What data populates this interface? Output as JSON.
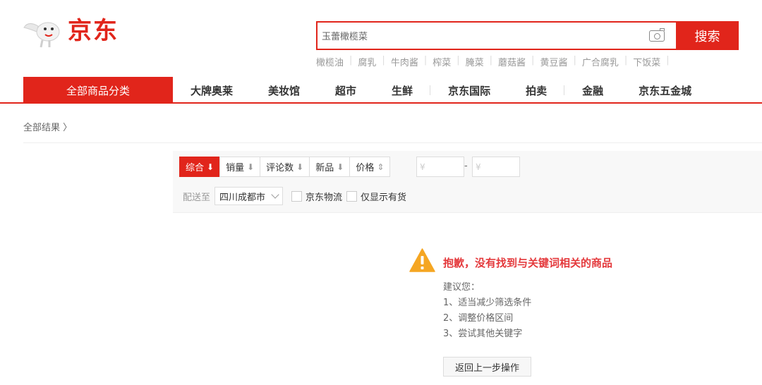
{
  "brand": {
    "logo_text": "京东",
    "color": "#e1251b"
  },
  "search": {
    "value": "玉蕾橄榄菜",
    "button": "搜索"
  },
  "hotwords": [
    "橄榄油",
    "腐乳",
    "牛肉酱",
    "榨菜",
    "腌菜",
    "蘑菇酱",
    "黄豆酱",
    "广合腐乳",
    "下饭菜"
  ],
  "nav": {
    "all_categories": "全部商品分类",
    "items": [
      "大牌奥莱",
      "美妆馆",
      "超市",
      "生鲜",
      "京东国际",
      "拍卖",
      "金融",
      "京东五金城"
    ]
  },
  "breadcrumb": {
    "label": "全部结果 〉"
  },
  "filter": {
    "sort": [
      {
        "label": "综合",
        "arrow": "⬇"
      },
      {
        "label": "销量",
        "arrow": "⬇"
      },
      {
        "label": "评论数",
        "arrow": "⬇"
      },
      {
        "label": "新品",
        "arrow": "⬇"
      },
      {
        "label": "价格",
        "arrow": "⇕"
      }
    ],
    "price_min_placeholder": "¥",
    "price_max_placeholder": "¥",
    "price_sep": "-",
    "ship_to_label": "配送至",
    "ship_to_value": "四川成都市",
    "check_jd_logistics": "京东物流",
    "check_in_stock": "仅显示有货"
  },
  "empty": {
    "title": "抱歉，没有找到与关键词相关的商品",
    "suggest_intro": "建议您：",
    "suggestions": [
      "1、适当减少筛选条件",
      "2、调整价格区间",
      "3、尝试其他关键字"
    ],
    "back_button": "返回上一步操作"
  }
}
